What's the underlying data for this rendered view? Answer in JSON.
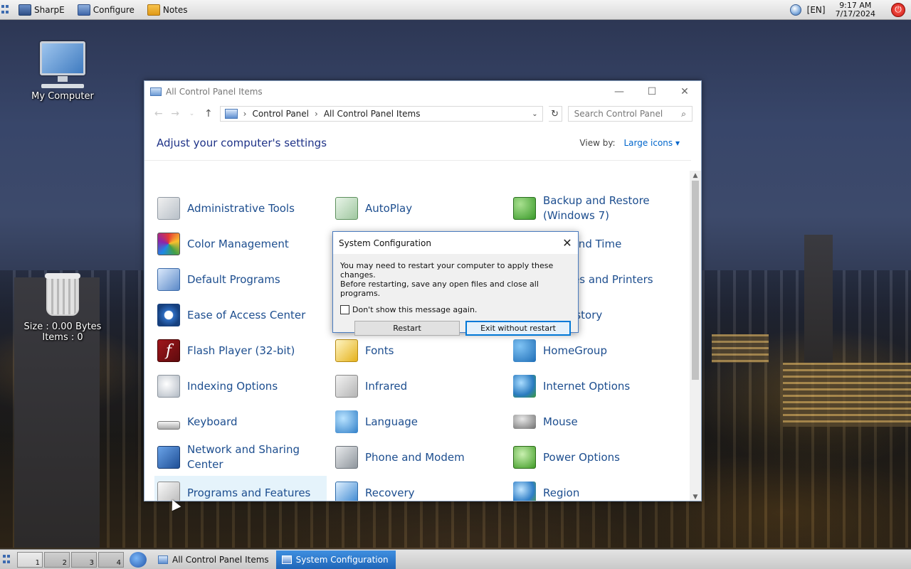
{
  "topbar": {
    "launchers": [
      {
        "label": "SharpE",
        "icon": "sharpe-icon"
      },
      {
        "label": "Configure",
        "icon": "configure-icon"
      },
      {
        "label": "Notes",
        "icon": "notes-icon"
      }
    ],
    "lang": "[EN]",
    "time": "9:17 AM",
    "date": "7/17/2024"
  },
  "desktop": {
    "my_computer": "My Computer",
    "trash_size": "Size : 0.00 Bytes",
    "trash_items": "Items : 0"
  },
  "control_panel": {
    "title": "All Control Panel Items",
    "breadcrumb": [
      "Control Panel",
      "All Control Panel Items"
    ],
    "search_placeholder": "Search Control Panel",
    "heading": "Adjust your computer's settings",
    "view_by_label": "View by:",
    "view_by_value": "Large icons",
    "items": [
      {
        "label": "Administrative Tools",
        "icon": "administrative-tools-icon"
      },
      {
        "label": "AutoPlay",
        "icon": "autoplay-icon"
      },
      {
        "label": "Backup and Restore (Windows 7)",
        "icon": "backup-restore-icon"
      },
      {
        "label": "Color Management",
        "icon": "color-management-icon"
      },
      {
        "label": "",
        "icon": ""
      },
      {
        "label": "Date and Time",
        "icon": "date-time-icon"
      },
      {
        "label": "Default Programs",
        "icon": "default-programs-icon"
      },
      {
        "label": "",
        "icon": ""
      },
      {
        "label": "Devices and Printers",
        "icon": "devices-printers-icon"
      },
      {
        "label": "Ease of Access Center",
        "icon": "ease-of-access-icon"
      },
      {
        "label": "",
        "icon": ""
      },
      {
        "label": "File History",
        "icon": "file-history-icon"
      },
      {
        "label": "Flash Player (32-bit)",
        "icon": "flash-player-icon"
      },
      {
        "label": "Fonts",
        "icon": "fonts-icon"
      },
      {
        "label": "HomeGroup",
        "icon": "homegroup-icon"
      },
      {
        "label": "Indexing Options",
        "icon": "indexing-options-icon"
      },
      {
        "label": "Infrared",
        "icon": "infrared-icon"
      },
      {
        "label": "Internet Options",
        "icon": "internet-options-icon"
      },
      {
        "label": "Keyboard",
        "icon": "keyboard-icon"
      },
      {
        "label": "Language",
        "icon": "language-icon"
      },
      {
        "label": "Mouse",
        "icon": "mouse-icon"
      },
      {
        "label": "Network and Sharing Center",
        "icon": "network-sharing-icon"
      },
      {
        "label": "Phone and Modem",
        "icon": "phone-modem-icon"
      },
      {
        "label": "Power Options",
        "icon": "power-options-icon"
      },
      {
        "label": "Programs and Features",
        "icon": "programs-features-icon"
      },
      {
        "label": "Recovery",
        "icon": "recovery-icon"
      },
      {
        "label": "Region",
        "icon": "region-icon"
      }
    ]
  },
  "dialog": {
    "title": "System Configuration",
    "message_line1": "You may need to restart your computer to apply these changes.",
    "message_line2": "Before restarting, save any open files and close all programs.",
    "checkbox_label": "Don't show this message again.",
    "restart_label": "Restart",
    "exit_label": "Exit without restart"
  },
  "taskbar": {
    "workspaces": [
      "1",
      "2",
      "3",
      "4"
    ],
    "tasks": [
      {
        "label": "All Control Panel Items",
        "active": false
      },
      {
        "label": "System Configuration",
        "active": true
      }
    ]
  }
}
